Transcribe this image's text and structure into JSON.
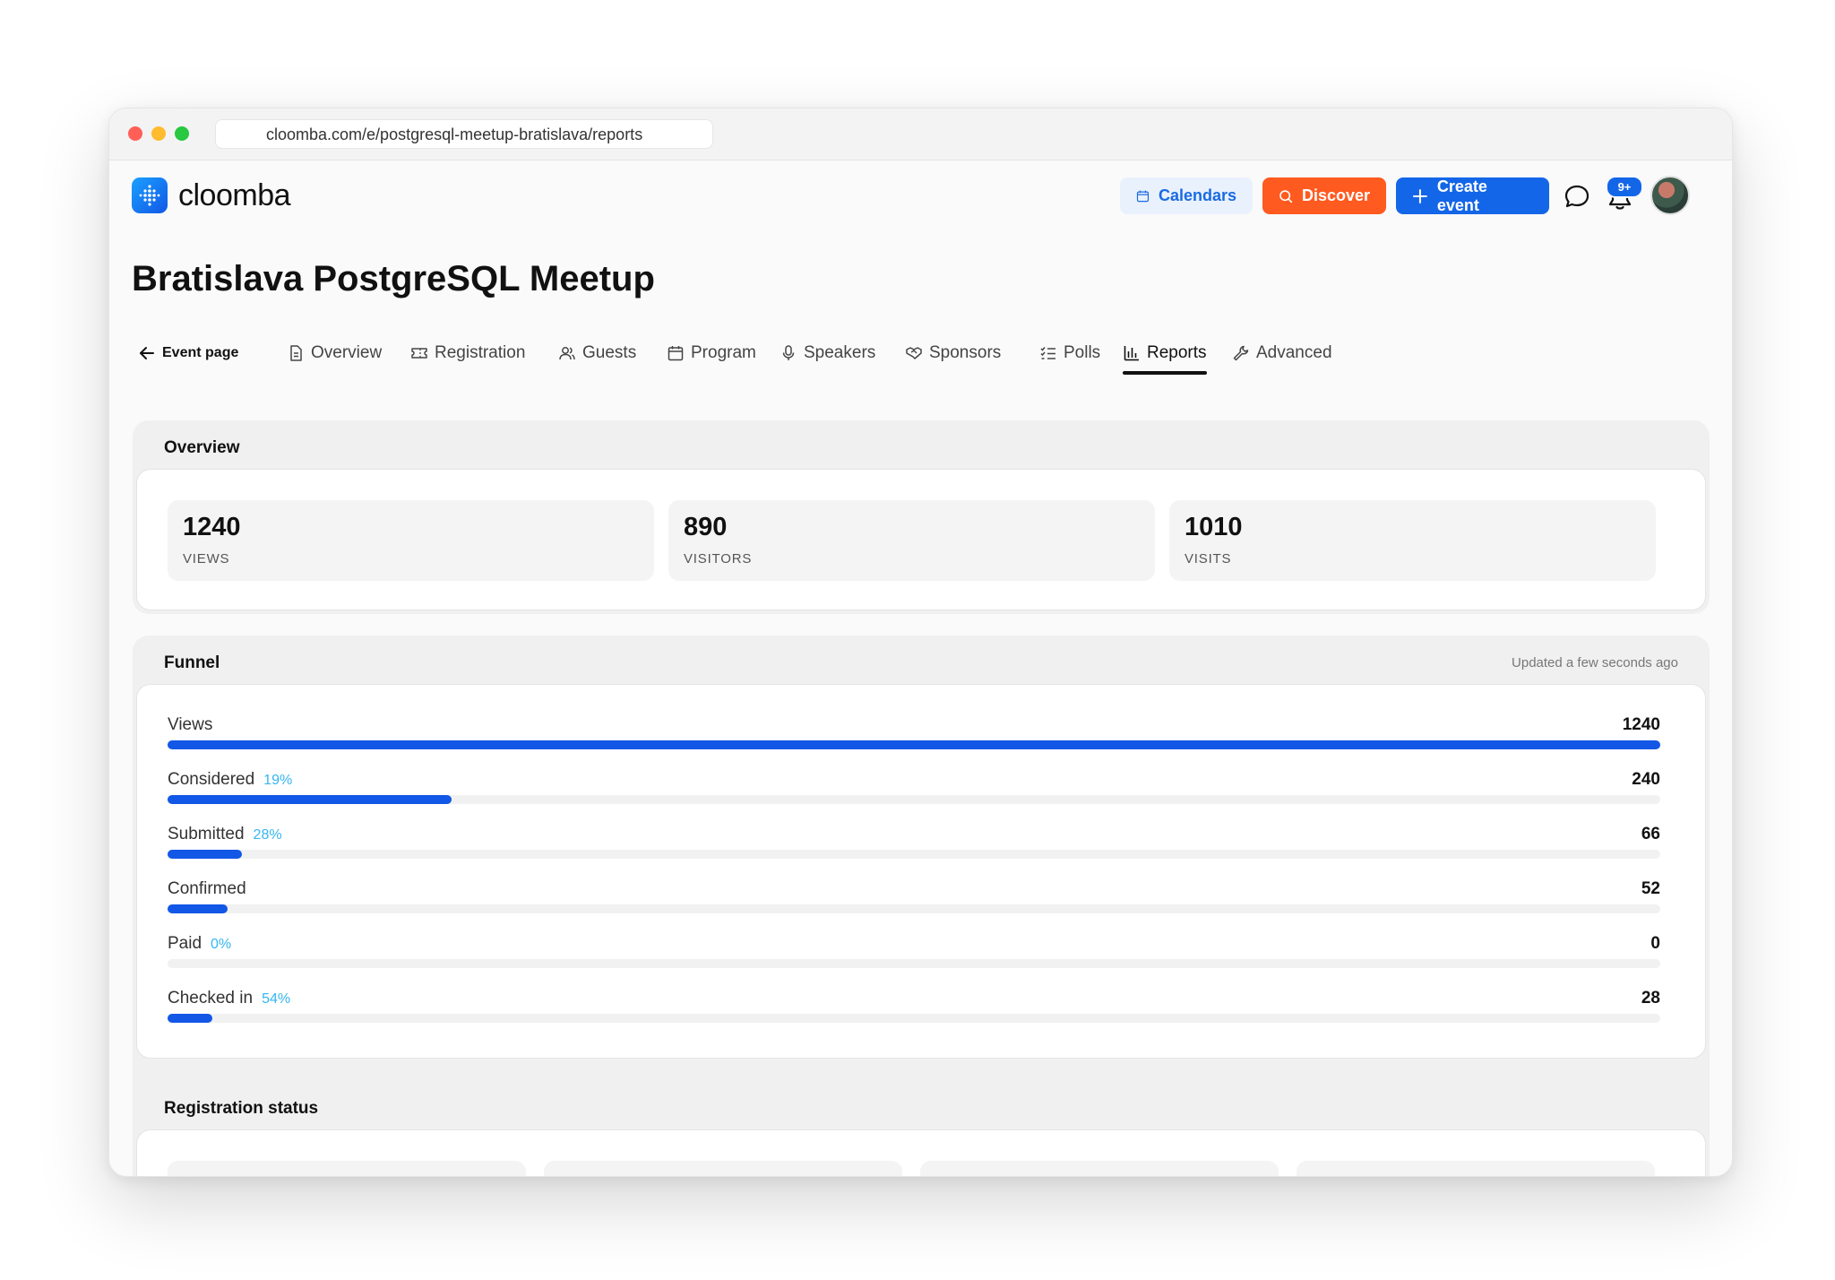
{
  "browser": {
    "url": "cloomba.com/e/postgresql-meetup-bratislava/reports"
  },
  "header": {
    "logo_text": "cloomba",
    "calendars_label": "Calendars",
    "discover_label": "Discover",
    "create_label": "Create event",
    "notification_badge": "9+"
  },
  "page": {
    "title": "Bratislava PostgreSQL Meetup"
  },
  "tabs": {
    "back": "Event page",
    "overview": "Overview",
    "registration": "Registration",
    "guests": "Guests",
    "program": "Program",
    "speakers": "Speakers",
    "sponsors": "Sponsors",
    "polls": "Polls",
    "reports": "Reports",
    "advanced": "Advanced",
    "active": "Reports"
  },
  "overview": {
    "title": "Overview",
    "stats": [
      {
        "value": "1240",
        "label": "VIEWS"
      },
      {
        "value": "890",
        "label": "VISITORS"
      },
      {
        "value": "1010",
        "label": "VISITS"
      }
    ]
  },
  "funnel": {
    "title": "Funnel",
    "updated": "Updated a few seconds ago",
    "rows": [
      {
        "label": "Views",
        "pct": "",
        "value": "1240",
        "fill": 1.0
      },
      {
        "label": "Considered",
        "pct": "19%",
        "value": "240",
        "fill": 0.19
      },
      {
        "label": "Submitted",
        "pct": "28%",
        "value": "66",
        "fill": 0.05
      },
      {
        "label": "Confirmed",
        "pct": "",
        "value": "52",
        "fill": 0.04
      },
      {
        "label": "Paid",
        "pct": "0%",
        "value": "0",
        "fill": 0.0
      },
      {
        "label": "Checked in",
        "pct": "54%",
        "value": "28",
        "fill": 0.03
      }
    ]
  },
  "registration_status": {
    "title": "Registration status"
  },
  "colors": {
    "accent": "#1257e6",
    "discover": "#ff5a1f",
    "create": "#1466e8",
    "pct": "#35b6f0"
  }
}
